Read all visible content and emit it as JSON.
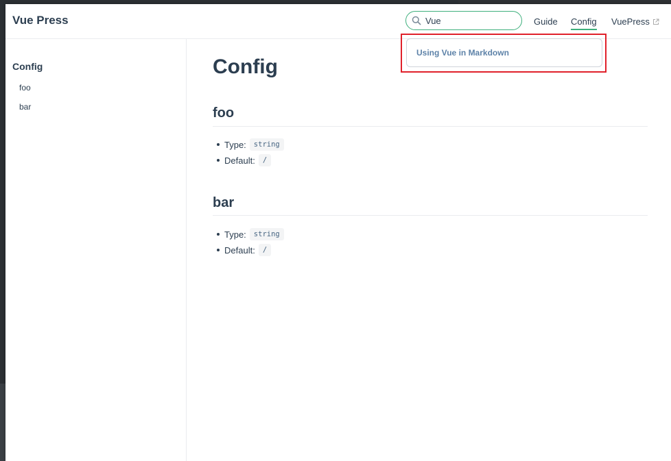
{
  "navbar": {
    "brand": "Vue Press",
    "search": {
      "value": "Vue",
      "placeholder": ""
    },
    "links": [
      {
        "label": "Guide"
      },
      {
        "label": "Config",
        "active": true
      },
      {
        "label": "VuePress",
        "external": true
      }
    ]
  },
  "search_suggestions": [
    {
      "label": "Using Vue in Markdown"
    }
  ],
  "sidebar": {
    "heading": "Config",
    "items": [
      {
        "label": "foo"
      },
      {
        "label": "bar"
      }
    ]
  },
  "content": {
    "title": "Config",
    "sections": [
      {
        "heading": "foo",
        "props": [
          {
            "label": "Type:",
            "value": "string"
          },
          {
            "label": "Default:",
            "value": "/"
          }
        ]
      },
      {
        "heading": "bar",
        "props": [
          {
            "label": "Type:",
            "value": "string"
          },
          {
            "label": "Default:",
            "value": "/"
          }
        ]
      }
    ]
  },
  "colors": {
    "accent": "#3eaf7c",
    "text": "#2c3e50",
    "suggestion": "#5d82a8",
    "highlight": "#e0202a",
    "code_text": "#476582",
    "code_bg": "#f3f4f5"
  },
  "icons": {
    "search": "search-icon",
    "external": "external-link-icon"
  }
}
